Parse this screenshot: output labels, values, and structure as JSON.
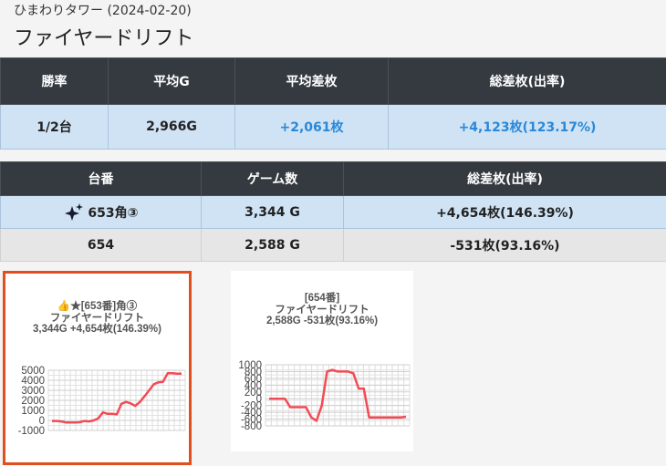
{
  "header": {
    "store": "ひまわりタワー (2024-02-20)",
    "machine": "ファイヤードリフト"
  },
  "summary": {
    "headers": [
      "勝率",
      "平均G",
      "平均差枚",
      "総差枚(出率)"
    ],
    "values": [
      "1/2台",
      "2,966G",
      "+2,061枚",
      "+4,123枚(123.17%)"
    ]
  },
  "units": {
    "headers": [
      "台番",
      "ゲーム数",
      "総差枚(出率)"
    ],
    "rows": [
      {
        "machine": "653角③",
        "games": "3,344 G",
        "diff": "+4,654枚(146.39%)",
        "sparkle_icon": "sparkles-icon"
      },
      {
        "machine": "654",
        "games": "2,588 G",
        "diff": "-531枚(93.16%)"
      }
    ]
  },
  "charts": [
    {
      "line1": "👍★[653番]角③",
      "line2": "ファイヤードリフト",
      "line3": "3,344G +4,654枚(146.39%)",
      "color": "#f24b55",
      "chart_data": {
        "type": "line",
        "ylim": [
          -1000,
          5000
        ],
        "yticks": [
          5000,
          4000,
          3000,
          2000,
          1000,
          0,
          -1000
        ],
        "y": [
          -50,
          -50,
          -100,
          -200,
          -200,
          -200,
          -180,
          -50,
          -100,
          0,
          200,
          800,
          650,
          650,
          600,
          1650,
          1850,
          1700,
          1450,
          1850,
          2400,
          3000,
          3600,
          3800,
          3850,
          4700,
          4700,
          4650,
          4654
        ]
      }
    },
    {
      "line1": "[654番]",
      "line2": "ファイヤードリフト",
      "line3": "2,588G -531枚(93.16%)",
      "color": "#f24b55",
      "chart_data": {
        "type": "line",
        "ylim": [
          -800,
          1000
        ],
        "yticks": [
          1000,
          800,
          600,
          400,
          200,
          0,
          -200,
          -400,
          -600,
          -800
        ],
        "y": [
          0,
          0,
          0,
          0,
          -250,
          -250,
          -250,
          -250,
          -550,
          -650,
          -200,
          800,
          850,
          800,
          800,
          800,
          750,
          300,
          300,
          -550,
          -550,
          -550,
          -550,
          -550,
          -550,
          -550,
          -531
        ]
      }
    }
  ]
}
